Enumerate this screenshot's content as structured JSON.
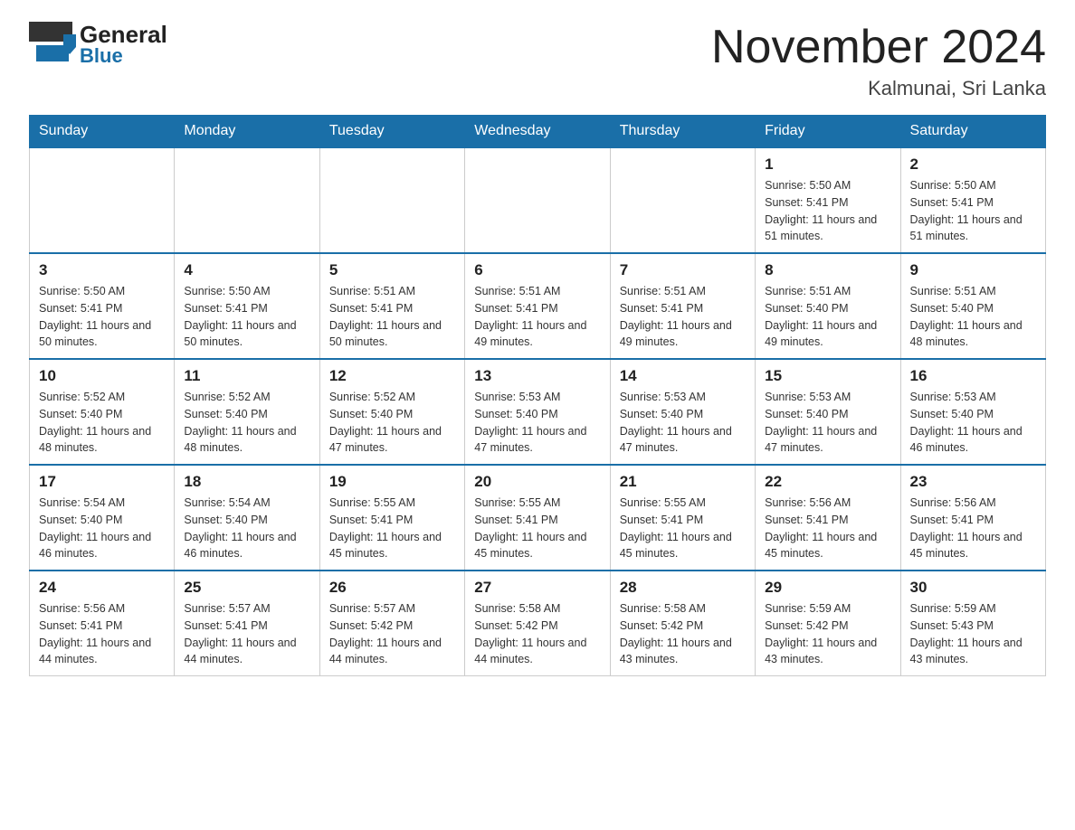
{
  "header": {
    "logo_general": "General",
    "logo_blue": "Blue",
    "month_title": "November 2024",
    "location": "Kalmunai, Sri Lanka"
  },
  "weekdays": [
    "Sunday",
    "Monday",
    "Tuesday",
    "Wednesday",
    "Thursday",
    "Friday",
    "Saturday"
  ],
  "weeks": [
    {
      "days": [
        {
          "date": "",
          "info": ""
        },
        {
          "date": "",
          "info": ""
        },
        {
          "date": "",
          "info": ""
        },
        {
          "date": "",
          "info": ""
        },
        {
          "date": "",
          "info": ""
        },
        {
          "date": "1",
          "info": "Sunrise: 5:50 AM\nSunset: 5:41 PM\nDaylight: 11 hours\nand 51 minutes."
        },
        {
          "date": "2",
          "info": "Sunrise: 5:50 AM\nSunset: 5:41 PM\nDaylight: 11 hours\nand 51 minutes."
        }
      ]
    },
    {
      "days": [
        {
          "date": "3",
          "info": "Sunrise: 5:50 AM\nSunset: 5:41 PM\nDaylight: 11 hours\nand 50 minutes."
        },
        {
          "date": "4",
          "info": "Sunrise: 5:50 AM\nSunset: 5:41 PM\nDaylight: 11 hours\nand 50 minutes."
        },
        {
          "date": "5",
          "info": "Sunrise: 5:51 AM\nSunset: 5:41 PM\nDaylight: 11 hours\nand 50 minutes."
        },
        {
          "date": "6",
          "info": "Sunrise: 5:51 AM\nSunset: 5:41 PM\nDaylight: 11 hours\nand 49 minutes."
        },
        {
          "date": "7",
          "info": "Sunrise: 5:51 AM\nSunset: 5:41 PM\nDaylight: 11 hours\nand 49 minutes."
        },
        {
          "date": "8",
          "info": "Sunrise: 5:51 AM\nSunset: 5:40 PM\nDaylight: 11 hours\nand 49 minutes."
        },
        {
          "date": "9",
          "info": "Sunrise: 5:51 AM\nSunset: 5:40 PM\nDaylight: 11 hours\nand 48 minutes."
        }
      ]
    },
    {
      "days": [
        {
          "date": "10",
          "info": "Sunrise: 5:52 AM\nSunset: 5:40 PM\nDaylight: 11 hours\nand 48 minutes."
        },
        {
          "date": "11",
          "info": "Sunrise: 5:52 AM\nSunset: 5:40 PM\nDaylight: 11 hours\nand 48 minutes."
        },
        {
          "date": "12",
          "info": "Sunrise: 5:52 AM\nSunset: 5:40 PM\nDaylight: 11 hours\nand 47 minutes."
        },
        {
          "date": "13",
          "info": "Sunrise: 5:53 AM\nSunset: 5:40 PM\nDaylight: 11 hours\nand 47 minutes."
        },
        {
          "date": "14",
          "info": "Sunrise: 5:53 AM\nSunset: 5:40 PM\nDaylight: 11 hours\nand 47 minutes."
        },
        {
          "date": "15",
          "info": "Sunrise: 5:53 AM\nSunset: 5:40 PM\nDaylight: 11 hours\nand 47 minutes."
        },
        {
          "date": "16",
          "info": "Sunrise: 5:53 AM\nSunset: 5:40 PM\nDaylight: 11 hours\nand 46 minutes."
        }
      ]
    },
    {
      "days": [
        {
          "date": "17",
          "info": "Sunrise: 5:54 AM\nSunset: 5:40 PM\nDaylight: 11 hours\nand 46 minutes."
        },
        {
          "date": "18",
          "info": "Sunrise: 5:54 AM\nSunset: 5:40 PM\nDaylight: 11 hours\nand 46 minutes."
        },
        {
          "date": "19",
          "info": "Sunrise: 5:55 AM\nSunset: 5:41 PM\nDaylight: 11 hours\nand 45 minutes."
        },
        {
          "date": "20",
          "info": "Sunrise: 5:55 AM\nSunset: 5:41 PM\nDaylight: 11 hours\nand 45 minutes."
        },
        {
          "date": "21",
          "info": "Sunrise: 5:55 AM\nSunset: 5:41 PM\nDaylight: 11 hours\nand 45 minutes."
        },
        {
          "date": "22",
          "info": "Sunrise: 5:56 AM\nSunset: 5:41 PM\nDaylight: 11 hours\nand 45 minutes."
        },
        {
          "date": "23",
          "info": "Sunrise: 5:56 AM\nSunset: 5:41 PM\nDaylight: 11 hours\nand 45 minutes."
        }
      ]
    },
    {
      "days": [
        {
          "date": "24",
          "info": "Sunrise: 5:56 AM\nSunset: 5:41 PM\nDaylight: 11 hours\nand 44 minutes."
        },
        {
          "date": "25",
          "info": "Sunrise: 5:57 AM\nSunset: 5:41 PM\nDaylight: 11 hours\nand 44 minutes."
        },
        {
          "date": "26",
          "info": "Sunrise: 5:57 AM\nSunset: 5:42 PM\nDaylight: 11 hours\nand 44 minutes."
        },
        {
          "date": "27",
          "info": "Sunrise: 5:58 AM\nSunset: 5:42 PM\nDaylight: 11 hours\nand 44 minutes."
        },
        {
          "date": "28",
          "info": "Sunrise: 5:58 AM\nSunset: 5:42 PM\nDaylight: 11 hours\nand 43 minutes."
        },
        {
          "date": "29",
          "info": "Sunrise: 5:59 AM\nSunset: 5:42 PM\nDaylight: 11 hours\nand 43 minutes."
        },
        {
          "date": "30",
          "info": "Sunrise: 5:59 AM\nSunset: 5:43 PM\nDaylight: 11 hours\nand 43 minutes."
        }
      ]
    }
  ]
}
